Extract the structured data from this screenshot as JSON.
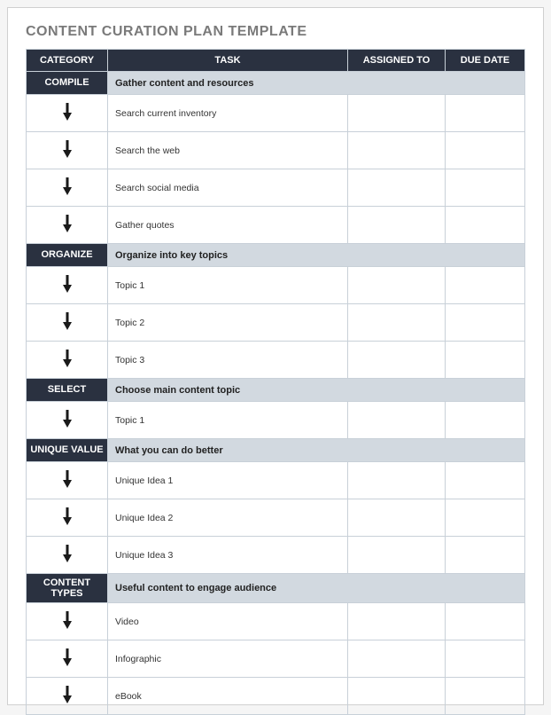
{
  "title": "CONTENT CURATION PLAN TEMPLATE",
  "columns": {
    "category": "CATEGORY",
    "task": "TASK",
    "assigned": "ASSIGNED TO",
    "due": "DUE DATE"
  },
  "sections": [
    {
      "label": "COMPILE",
      "desc": "Gather content and resources",
      "rows": [
        {
          "task": "Search current inventory",
          "assigned": "",
          "due": ""
        },
        {
          "task": "Search the web",
          "assigned": "",
          "due": ""
        },
        {
          "task": "Search social media",
          "assigned": "",
          "due": ""
        },
        {
          "task": "Gather quotes",
          "assigned": "",
          "due": ""
        }
      ]
    },
    {
      "label": "ORGANIZE",
      "desc": "Organize into key topics",
      "rows": [
        {
          "task": "Topic 1",
          "assigned": "",
          "due": ""
        },
        {
          "task": "Topic 2",
          "assigned": "",
          "due": ""
        },
        {
          "task": "Topic 3",
          "assigned": "",
          "due": ""
        }
      ]
    },
    {
      "label": "SELECT",
      "desc": "Choose main content topic",
      "rows": [
        {
          "task": "Topic 1",
          "assigned": "",
          "due": ""
        }
      ]
    },
    {
      "label": "UNIQUE VALUE",
      "desc": "What you can do better",
      "rows": [
        {
          "task": "Unique Idea 1",
          "assigned": "",
          "due": ""
        },
        {
          "task": "Unique Idea 2",
          "assigned": "",
          "due": ""
        },
        {
          "task": "Unique Idea 3",
          "assigned": "",
          "due": ""
        }
      ]
    },
    {
      "label": "CONTENT TYPES",
      "desc": "Useful content to engage audience",
      "rows": [
        {
          "task": "Video",
          "assigned": "",
          "due": ""
        },
        {
          "task": "Infographic",
          "assigned": "",
          "due": ""
        },
        {
          "task": "eBook",
          "assigned": "",
          "due": ""
        }
      ]
    }
  ]
}
